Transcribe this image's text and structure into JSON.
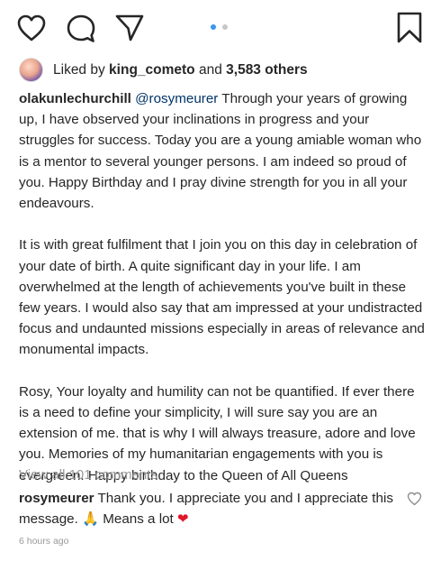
{
  "actions": {
    "like_icon": "heart-outline-icon",
    "comment_icon": "speech-bubble-icon",
    "share_icon": "paper-plane-icon",
    "save_icon": "bookmark-icon"
  },
  "carousel": {
    "total": 2,
    "active_index": 0
  },
  "likes": {
    "prefix": "Liked by ",
    "user": "king_cometo",
    "joiner": " and ",
    "count": "3,583 others"
  },
  "caption": {
    "author": "olakunlechurchill",
    "mention": "@rosymeurer",
    "paragraph1": " Through your years of growing up, I have observed your inclinations in progress and your struggles for success. Today you are a young amiable woman who is a mentor to several younger persons. I am indeed so proud of you. Happy Birthday and I pray divine strength for you in all your endeavours.",
    "paragraph2": "It is with great fulfilment that I join you on this day in celebration of your date of birth. A quite significant day in your life. I am overwhelmed at the length of achievements you've built in these few years. I would also say that am impressed at your undistracted focus and undaunted missions especially in areas of relevance and monumental impacts.",
    "paragraph3": "Rosy, Your loyalty and humility can not be quantified. If ever there is a need to define your simplicity, I will sure say you are an extension of me. that is why I will always treasure, adore and love you. Memories of my humanitarian engagements with you is evergreen. Happy birthday to the Queen of All Queens"
  },
  "comments": {
    "view_all": "View all 101 comments"
  },
  "comment": {
    "author": "rosymeurer",
    "text": " Thank you. I appreciate you and I appreciate this message. ",
    "hands": "🙏",
    "after": " Means a lot ",
    "heart": "❤",
    "like_icon": "heart-outline-icon"
  },
  "timestamp": "6 hours ago",
  "colors": {
    "text": "#262626",
    "muted": "#999999",
    "accent": "#3897f0",
    "mention": "#003569"
  }
}
